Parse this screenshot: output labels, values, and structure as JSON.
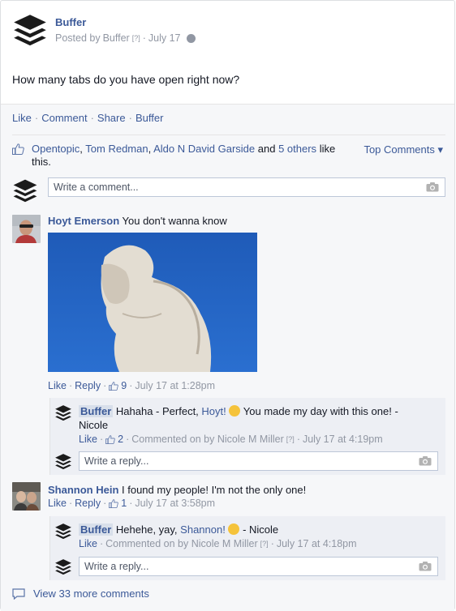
{
  "post": {
    "author": "Buffer",
    "posted_by_prefix": "Posted by",
    "posted_by_name": "Buffer",
    "qmark": "[?]",
    "sep": "·",
    "date": "July 17",
    "text": "How many tabs do you have open right now?"
  },
  "actions": {
    "like": "Like",
    "comment": "Comment",
    "share": "Share",
    "buffer": "Buffer",
    "sep": "·"
  },
  "likes": {
    "names": [
      "Opentopic",
      "Tom Redman",
      "Aldo N David Garside"
    ],
    "and_text": "and",
    "others": "5 others",
    "suffix": "like this.",
    "comma": ","
  },
  "top_comments": "Top Comments ▾",
  "comment_box": {
    "placeholder": "Write a comment..."
  },
  "comments": [
    {
      "name": "Hoyt Emerson",
      "text": "You don't wanna know",
      "meta": {
        "like": "Like",
        "reply": "Reply",
        "likes": "9",
        "date": "July 17 at 1:28pm"
      },
      "reply": {
        "page": "Buffer",
        "text_a": "Hahaha - Perfect,",
        "mention": "Hoyt!",
        "text_b": "You made my day with this one! -",
        "text_c": "Nicole",
        "meta": {
          "like": "Like",
          "likes": "2",
          "commented_on_by": "Commented on by Nicole M Miller",
          "qmark": "[?]",
          "date": "July 17 at 4:19pm"
        }
      },
      "reply_box": {
        "placeholder": "Write a reply..."
      }
    },
    {
      "name": "Shannon Hein",
      "text": "I found my people! I'm not the only one!",
      "meta": {
        "like": "Like",
        "reply": "Reply",
        "likes": "1",
        "date": "July 17 at 3:58pm"
      },
      "reply": {
        "page": "Buffer",
        "text_a": "Hehehe, yay,",
        "mention": "Shannon!",
        "text_b": "- Nicole",
        "meta": {
          "like": "Like",
          "commented_on_by": "Commented on by Nicole M Miller",
          "qmark": "[?]",
          "date": "July 17 at 4:18pm"
        }
      },
      "reply_box": {
        "placeholder": "Write a reply..."
      }
    }
  ],
  "view_more": "View 33 more comments",
  "colors": {
    "link": "#3b5998",
    "muted": "#9197a3",
    "panel": "#f6f7f9"
  }
}
